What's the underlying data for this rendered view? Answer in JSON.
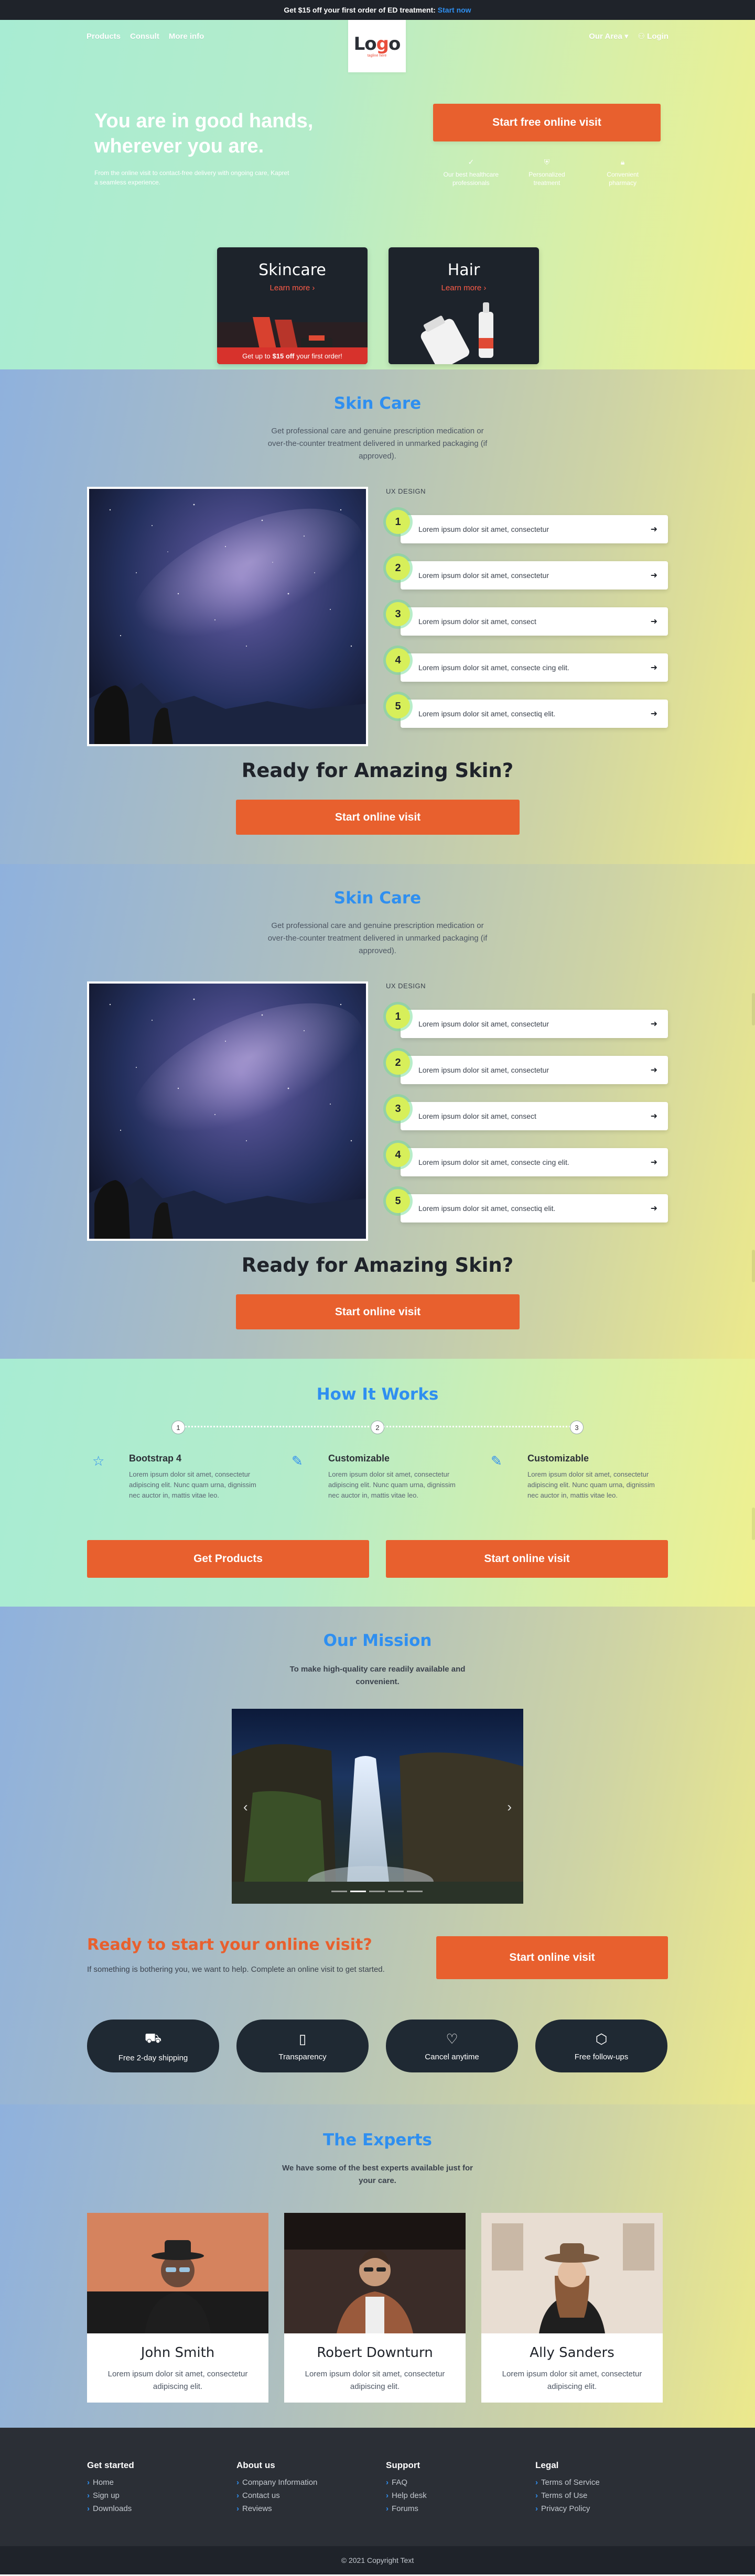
{
  "promo": {
    "text": "Get $15 off your first order of ED treatment:",
    "link": "Start now"
  },
  "nav": {
    "left": [
      "Products",
      "Consult",
      "More info"
    ],
    "logo": "Logo",
    "logo_tagline": "tagline here",
    "area": "Our Area",
    "login": "Login"
  },
  "hero": {
    "title": "You are in good hands, wherever you are.",
    "subtitle": "From the online visit to contact-free delivery with ongoing care, Kapret a seamless experience.",
    "cta": "Start free online visit",
    "features": [
      {
        "icon": "check-icon",
        "label": "Our best healthcare professionals"
      },
      {
        "icon": "shield-icon",
        "label": "Personalized treatment"
      },
      {
        "icon": "lock-icon",
        "label": "Convenient pharmacy"
      }
    ],
    "cards": [
      {
        "title": "Skincare",
        "more": "Learn more",
        "ribbon_pre": "Get up to",
        "ribbon_bold": "$15 off",
        "ribbon_post": "your first order!"
      },
      {
        "title": "Hair",
        "more": "Learn more"
      }
    ]
  },
  "skin_sections": [
    {
      "title": "Skin Care",
      "desc": "Get professional care and genuine prescription medication or over-the-counter treatment delivered in unmarked packaging (if approved).",
      "ux_label": "UX DESIGN",
      "steps": [
        {
          "num": "1",
          "text": "Lorem ipsum dolor sit amet, consectetur"
        },
        {
          "num": "2",
          "text": "Lorem ipsum dolor sit amet, consectetur"
        },
        {
          "num": "3",
          "text": "Lorem ipsum dolor sit amet, consect"
        },
        {
          "num": "4",
          "text": "Lorem ipsum dolor sit amet, consecte cing elit."
        },
        {
          "num": "5",
          "text": "Lorem ipsum dolor sit amet, consectiq elit."
        }
      ],
      "ready": "Ready for Amazing Skin?",
      "cta": "Start online visit"
    },
    {
      "title": "Skin Care",
      "desc": "Get professional care and genuine prescription medication or over-the-counter treatment delivered in unmarked packaging (if approved).",
      "ux_label": "UX DESIGN",
      "steps": [
        {
          "num": "1",
          "text": "Lorem ipsum dolor sit amet, consectetur"
        },
        {
          "num": "2",
          "text": "Lorem ipsum dolor sit amet, consectetur"
        },
        {
          "num": "3",
          "text": "Lorem ipsum dolor sit amet, consect"
        },
        {
          "num": "4",
          "text": "Lorem ipsum dolor sit amet, consecte cing elit."
        },
        {
          "num": "5",
          "text": "Lorem ipsum dolor sit amet, consectiq elit."
        }
      ],
      "ready": "Ready for Amazing Skin?",
      "cta": "Start online visit"
    }
  ],
  "how": {
    "title": "How It Works",
    "steps": [
      "1",
      "2",
      "3"
    ],
    "cols": [
      {
        "icon": "star-icon",
        "title": "Bootstrap 4",
        "text": "Lorem ipsum dolor sit amet, consectetur adipiscing elit. Nunc quam urna, dignissim nec auctor in, mattis vitae leo."
      },
      {
        "icon": "pencil-icon",
        "title": "Customizable",
        "text": "Lorem ipsum dolor sit amet, consectetur adipiscing elit. Nunc quam urna, dignissim nec auctor in, mattis vitae leo."
      },
      {
        "icon": "pencil-icon",
        "title": "Customizable",
        "text": "Lorem ipsum dolor sit amet, consectetur adipiscing elit. Nunc quam urna, dignissim nec auctor in, mattis vitae leo."
      }
    ],
    "btn_products": "Get Products",
    "btn_visit": "Start online visit"
  },
  "mission": {
    "title": "Our Mission",
    "subtitle": "To make high-quality care readily available and convenient.",
    "start_title": "Ready to start your online visit?",
    "start_sub": "If something is bothering you, we want to help. Complete an online visit to get started.",
    "start_cta": "Start online visit",
    "perks": [
      {
        "icon": "truck-icon",
        "label": "Free 2-day shipping"
      },
      {
        "icon": "document-icon",
        "label": "Transparency"
      },
      {
        "icon": "heart-icon",
        "label": "Cancel anytime"
      },
      {
        "icon": "chat-icon",
        "label": "Free follow-ups"
      }
    ]
  },
  "experts": {
    "title": "The Experts",
    "subtitle": "We have some of the best experts available just for your care.",
    "people": [
      {
        "name": "John Smith",
        "text": "Lorem ipsum dolor sit amet, consectetur adipiscing elit."
      },
      {
        "name": "Robert Downturn",
        "text": "Lorem ipsum dolor sit amet, consectetur adipiscing elit."
      },
      {
        "name": "Ally Sanders",
        "text": "Lorem ipsum dolor sit amet, consectetur adipiscing elit."
      }
    ]
  },
  "footer": {
    "cols": [
      {
        "title": "Get started",
        "links": [
          "Home",
          "Sign up",
          "Downloads"
        ]
      },
      {
        "title": "About us",
        "links": [
          "Company Information",
          "Contact us",
          "Reviews"
        ]
      },
      {
        "title": "Support",
        "links": [
          "FAQ",
          "Help desk",
          "Forums"
        ]
      },
      {
        "title": "Legal",
        "links": [
          "Terms of Service",
          "Terms of Use",
          "Privacy Policy"
        ]
      }
    ],
    "copyright": "© 2021 Copyright Text"
  },
  "colors": {
    "accent": "#e8602e",
    "link": "#2f8ff0",
    "dark": "#1f232a",
    "step_badge": "#d7ef5a"
  }
}
